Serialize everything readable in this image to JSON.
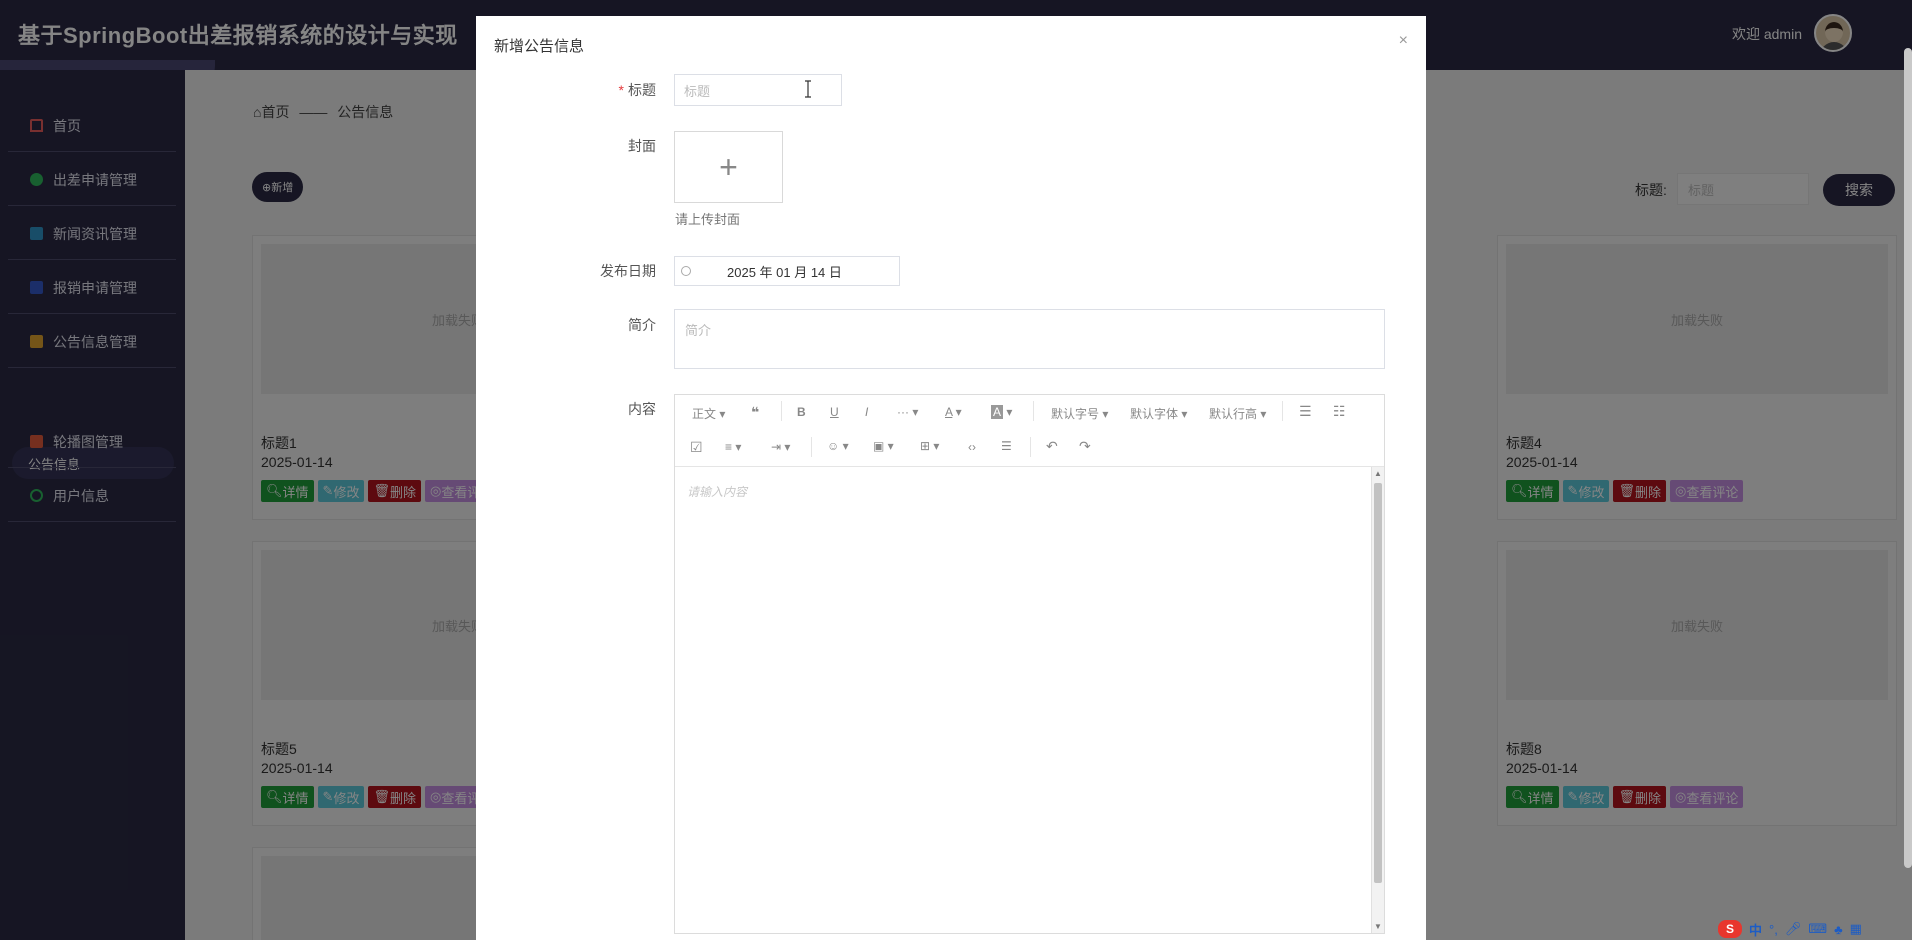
{
  "app": {
    "title": "基于SpringBoot出差报销系统的设计与实现",
    "welcome": "欢迎 admin"
  },
  "sidebar": {
    "items": [
      {
        "label": "首页",
        "color": "#e85c5c"
      },
      {
        "label": "出差申请管理",
        "color": "#2eb85c"
      },
      {
        "label": "新闻资讯管理",
        "color": "#2f94c7"
      },
      {
        "label": "报销申请管理",
        "color": "#3558c9"
      },
      {
        "label": "公告信息管理",
        "color": "#e0a32e"
      },
      {
        "label": "轮播图管理",
        "color": "#e25a3c"
      },
      {
        "label": "用户信息",
        "color": "#2eb85c"
      }
    ],
    "sub_item": "公告信息"
  },
  "breadcrumb": {
    "home": "首页",
    "sep": "——",
    "current": "公告信息"
  },
  "toolbar": {
    "add_label": "⊕新增",
    "search_label": "标题:",
    "search_placeholder": "标题",
    "search_button": "搜索"
  },
  "cards": [
    {
      "title": "标题1",
      "date": "2025-01-14",
      "img_text": "加载失败"
    },
    {
      "title": "标题4",
      "date": "2025-01-14",
      "img_text": "加载失败"
    },
    {
      "title": "标题5",
      "date": "2025-01-14",
      "img_text": "加载失败"
    },
    {
      "title": "标题8",
      "date": "2025-01-14",
      "img_text": "加载失败"
    }
  ],
  "card_buttons": {
    "detail": "详情",
    "edit": "修改",
    "delete": "删除",
    "comments": "查看评论"
  },
  "modal": {
    "title": "新增公告信息",
    "close": "×",
    "fields": {
      "title_label": "标题",
      "title_required": "*",
      "title_placeholder": "标题",
      "cover_label": "封面",
      "cover_tip": "请上传封面",
      "cover_plus": "+",
      "date_label": "发布日期",
      "date_value": "2025 年 01 月 14 日",
      "intro_label": "简介",
      "intro_placeholder": "简介",
      "content_label": "内容",
      "content_placeholder": "请输入内容"
    },
    "editor_toolbar": {
      "paragraph": "正文",
      "quote": "❝",
      "bold": "B",
      "underline": "U",
      "italic": "I",
      "more": "···",
      "font_color": "A",
      "bg_color": "A",
      "font_size": "默认字号",
      "font_family": "默认字体",
      "line_height": "默认行高"
    }
  },
  "taskbar": {
    "ime": "S",
    "lang": "中"
  }
}
